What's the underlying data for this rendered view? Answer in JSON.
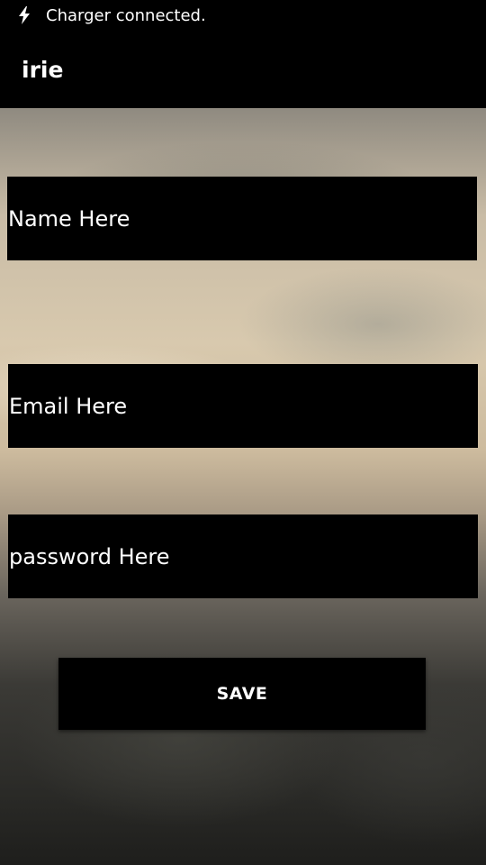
{
  "status_bar": {
    "icon": "charger-icon",
    "text": "Charger connected."
  },
  "app_bar": {
    "title": "irie"
  },
  "form": {
    "name_placeholder": "Name Here",
    "email_placeholder": "Email Here",
    "password_placeholder": "password Here",
    "save_label": "SAVE"
  },
  "colors": {
    "bars": "#000000",
    "field_background": "#000000",
    "text": "#ffffff"
  }
}
